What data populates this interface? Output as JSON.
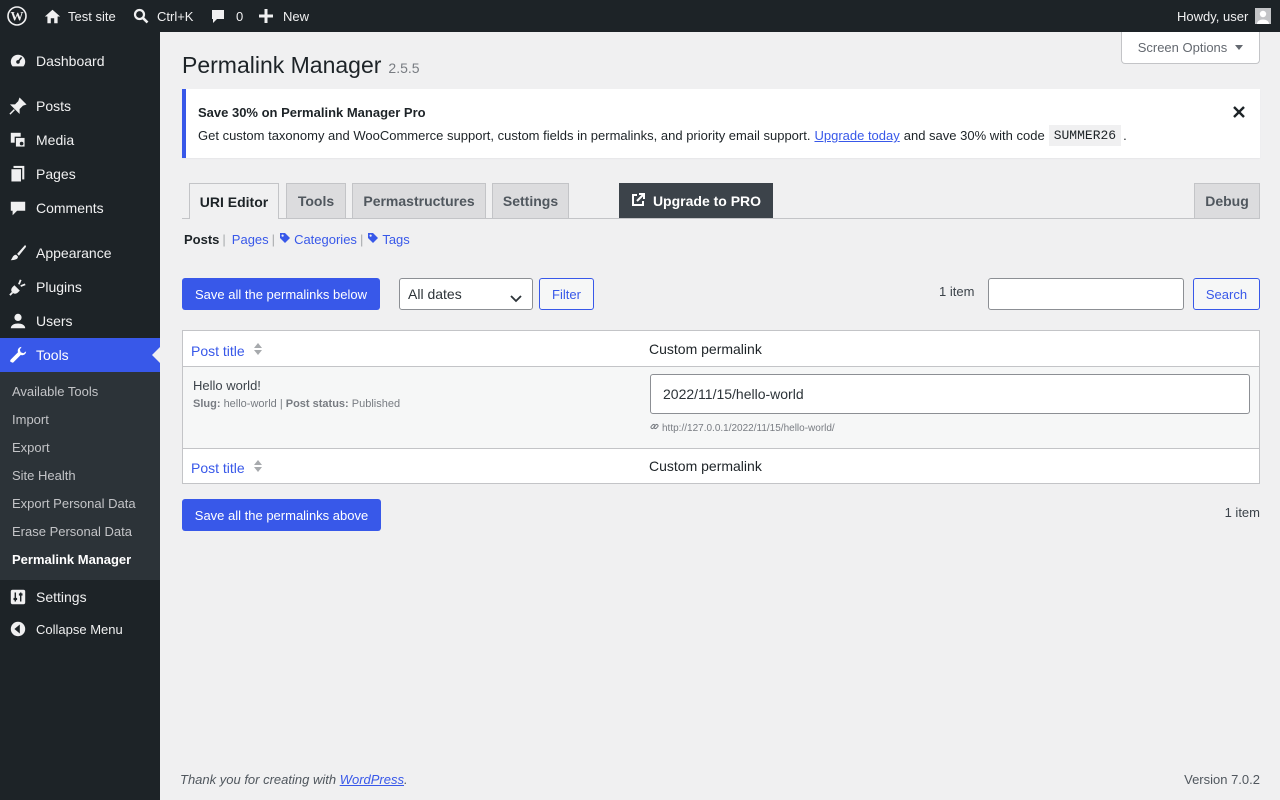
{
  "adminbar": {
    "site_name": "Test site",
    "search_shortcut": "Ctrl+K",
    "comments_count": "0",
    "new_label": "New",
    "howdy": "Howdy, user"
  },
  "sidebar": {
    "items": [
      {
        "label": "Dashboard",
        "icon": "dashboard-icon"
      },
      {
        "label": "Posts",
        "icon": "pin-icon"
      },
      {
        "label": "Media",
        "icon": "media-icon"
      },
      {
        "label": "Pages",
        "icon": "pages-icon"
      },
      {
        "label": "Comments",
        "icon": "comment-icon"
      },
      {
        "label": "Appearance",
        "icon": "brush-icon"
      },
      {
        "label": "Plugins",
        "icon": "plug-icon"
      },
      {
        "label": "Users",
        "icon": "user-icon"
      },
      {
        "label": "Tools",
        "icon": "wrench-icon"
      },
      {
        "label": "Settings",
        "icon": "sliders-icon"
      },
      {
        "label": "Collapse Menu",
        "icon": "collapse-icon"
      }
    ],
    "submenu": [
      "Available Tools",
      "Import",
      "Export",
      "Site Health",
      "Export Personal Data",
      "Erase Personal Data",
      "Permalink Manager"
    ]
  },
  "header": {
    "screen_options": "Screen Options",
    "title": "Permalink Manager",
    "version": "2.5.5"
  },
  "notice": {
    "title": "Save 30% on Permalink Manager Pro",
    "text_before": "Get custom taxonomy and WooCommerce support, custom fields in permalinks, and priority email support.",
    "link": "Upgrade today",
    "text_after": "and save 30% with code",
    "code": "SUMMER26",
    "period": "."
  },
  "tabs": {
    "uri_editor": "URI Editor",
    "tools": "Tools",
    "permastructures": "Permastructures",
    "settings": "Settings",
    "upgrade": "Upgrade to PRO",
    "debug": "Debug"
  },
  "subsubsub": {
    "posts": "Posts",
    "pages": "Pages",
    "categories": "Categories",
    "tags": "Tags",
    "sep": "|"
  },
  "tablenav_top": {
    "save_button": "Save all the permalinks below",
    "date_filter": "All dates",
    "filter_button": "Filter",
    "item_count": "1 item",
    "search_button": "Search"
  },
  "table": {
    "col_title": "Post title",
    "col_permalink": "Custom permalink",
    "rows": [
      {
        "title": "Hello world!",
        "slug_label": "Slug:",
        "slug": "hello-world",
        "status_label": "Post status:",
        "status": "Published",
        "permalink": "2022/11/15/hello-world",
        "url": "http://127.0.0.1/2022/11/15/hello-world/"
      }
    ]
  },
  "tablenav_bottom": {
    "save_button": "Save all the permalinks above",
    "item_count": "1 item"
  },
  "footer": {
    "thanks_before": "Thank you for creating with",
    "thanks_link": "WordPress",
    "thanks_after": ".",
    "version": "Version 7.0.2"
  },
  "colors": {
    "accent": "#3858e9",
    "admin_dark": "#1d2327"
  }
}
